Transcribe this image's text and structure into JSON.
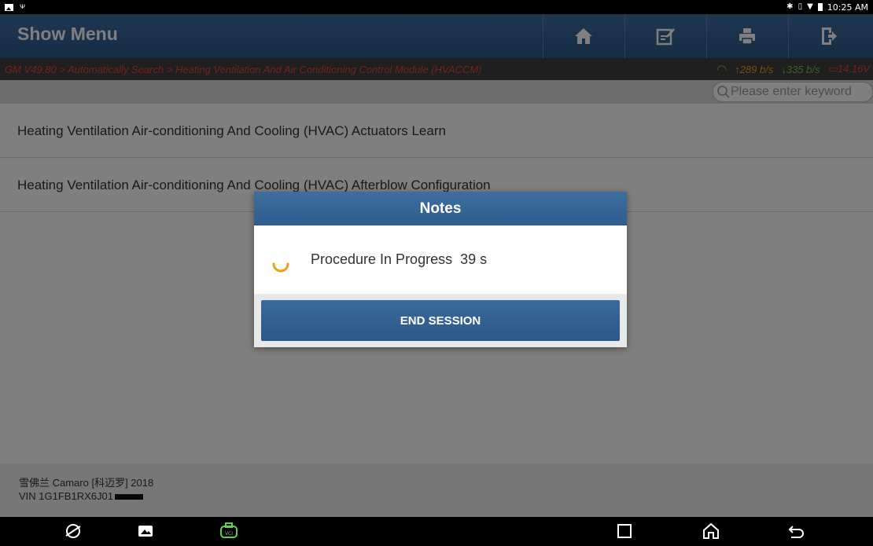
{
  "status_bar": {
    "time": "10:25 AM",
    "left_icons": [
      "gallery-icon",
      "usb-icon"
    ],
    "right_icons": [
      "bluetooth-icon",
      "vibrate-icon",
      "wifi-icon",
      "battery-icon"
    ]
  },
  "header": {
    "title": "Show Menu",
    "buttons": [
      {
        "name": "home-button",
        "icon": "home-icon"
      },
      {
        "name": "edit-button",
        "icon": "edit-icon"
      },
      {
        "name": "print-button",
        "icon": "printer-icon"
      },
      {
        "name": "exit-button",
        "icon": "exit-icon"
      }
    ]
  },
  "breadcrumb": {
    "path": "GM V49.80 > Automatically Search > Heating Ventilation And Air Conditioning Control Module (HVACCM)",
    "upload": "289 b/s",
    "download": "335 b/s",
    "voltage": "14.16V"
  },
  "search": {
    "placeholder": "Please enter keyword"
  },
  "menu": {
    "items": [
      {
        "label": "Heating Ventilation Air-conditioning And Cooling (HVAC) Actuators Learn"
      },
      {
        "label": "Heating Ventilation Air-conditioning And Cooling (HVAC) Afterblow Configuration"
      }
    ]
  },
  "dialog": {
    "title": "Notes",
    "message": "Procedure In Progress  39 s",
    "button": "END SESSION"
  },
  "vehicle": {
    "model": "雪佛兰 Camaro [科迈罗] 2018",
    "vin": "VIN 1G1FB1RX6J01"
  },
  "colors": {
    "header_blue": "#2c5a8a",
    "breadcrumb_red": "#e8443a",
    "upload_orange": "#f39a1a",
    "download_green": "#79c542",
    "spinner_orange": "#f39a1a"
  }
}
